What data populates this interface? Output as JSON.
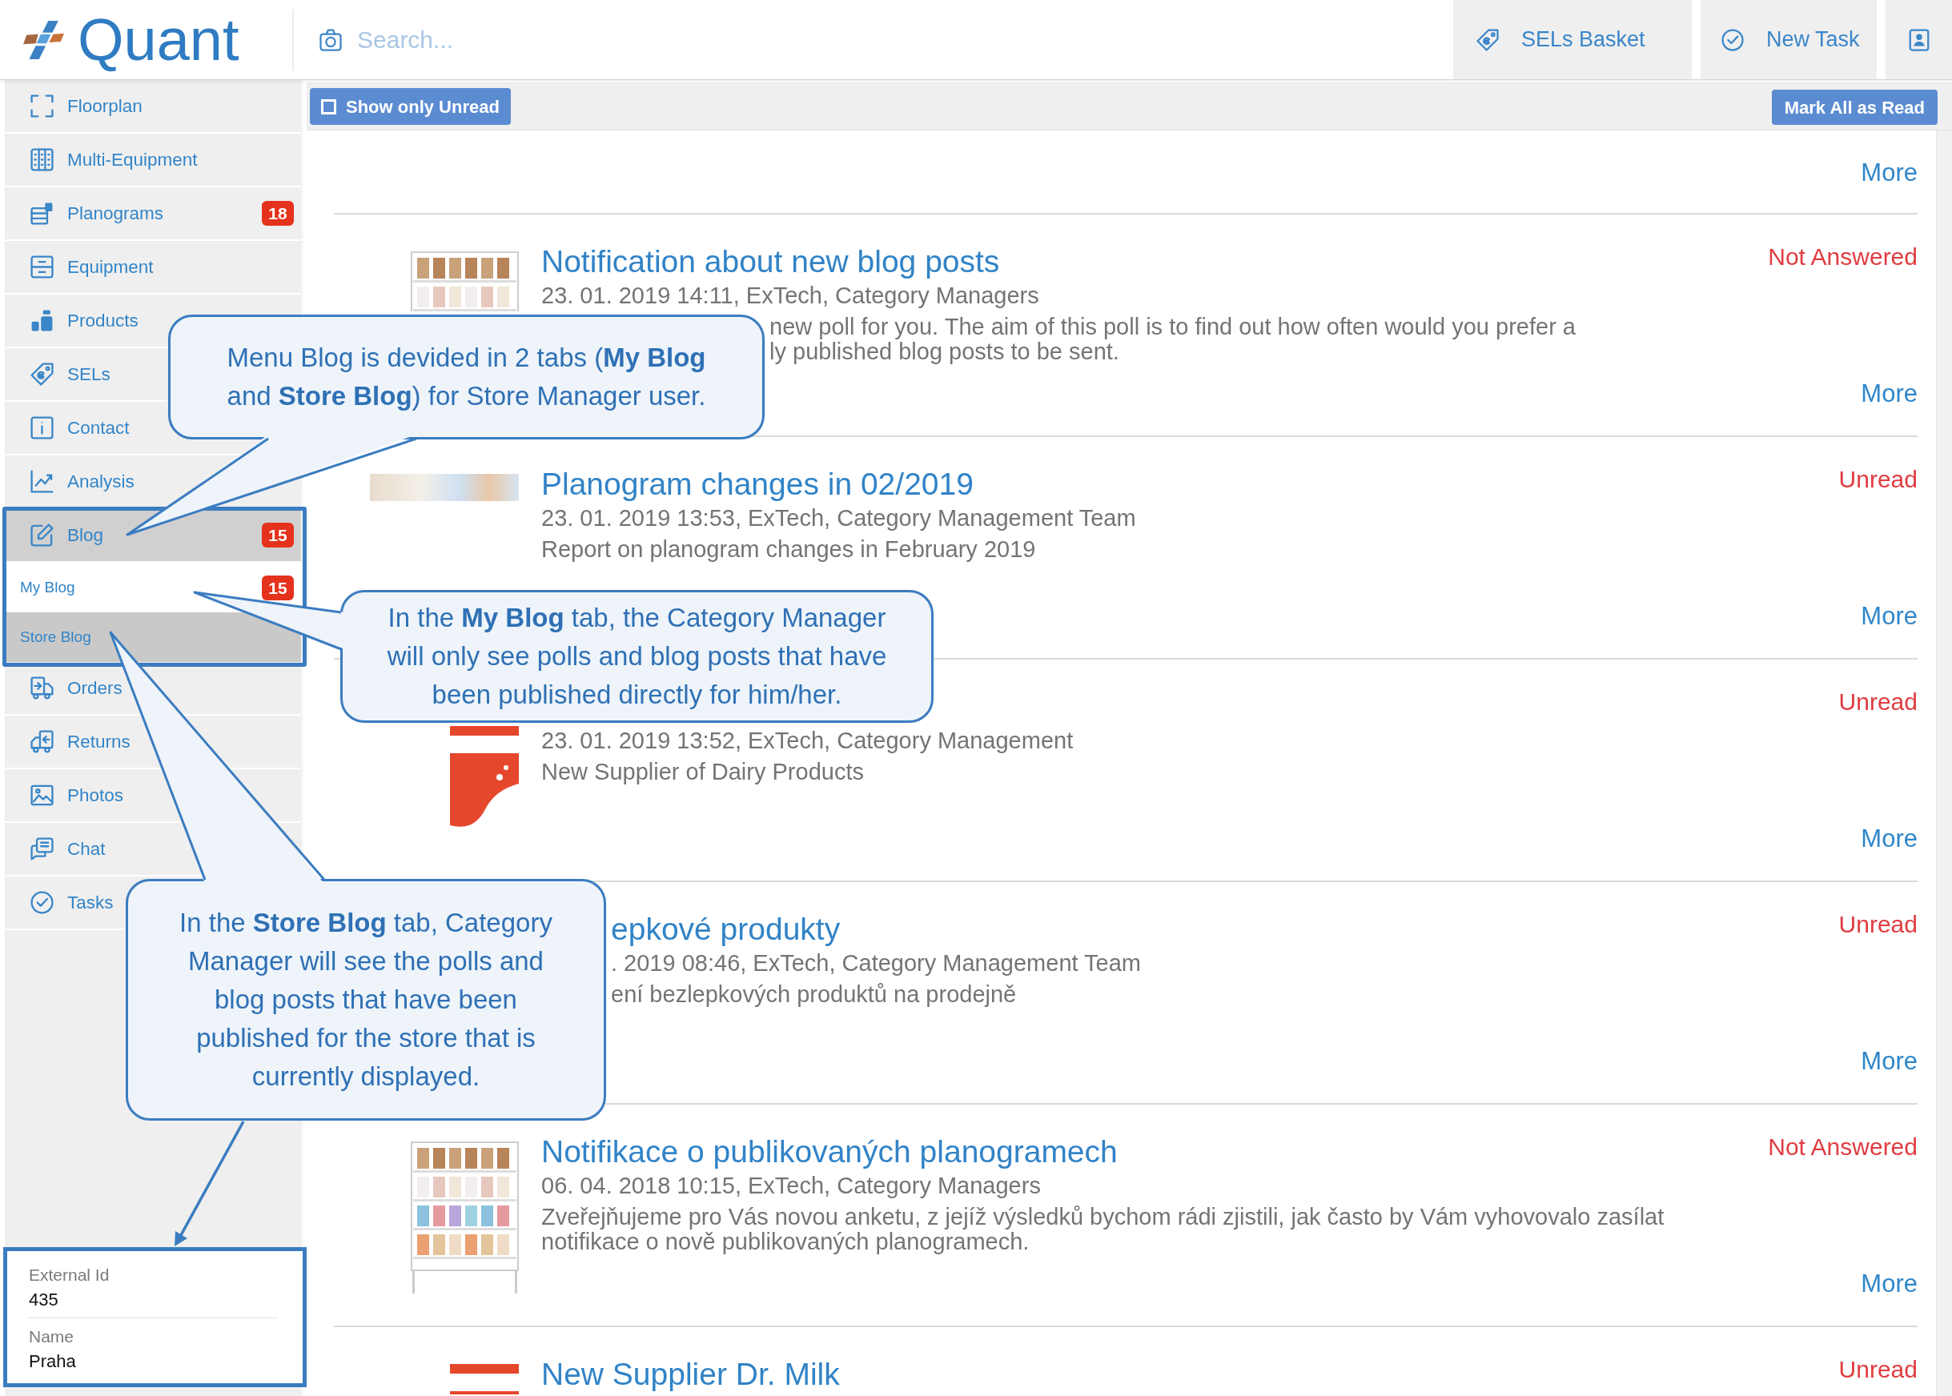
{
  "header": {
    "logo": "Quant",
    "search": {
      "placeholder": "Search..."
    },
    "buttons": [
      {
        "label": "SELs Basket"
      },
      {
        "label": "New Task"
      }
    ]
  },
  "sidebar": {
    "items": [
      {
        "label": "Floorplan",
        "selected": false
      },
      {
        "label": "Multi-Equipment",
        "selected": false
      },
      {
        "label": "Planograms",
        "badge": "18",
        "selected": false
      },
      {
        "label": "Equipment",
        "selected": false
      },
      {
        "label": "Products",
        "selected": false
      },
      {
        "label": "SELs",
        "selected": false
      },
      {
        "label": "Contact",
        "selected": false
      },
      {
        "label": "Analysis",
        "selected": false
      },
      {
        "label": "Blog",
        "badge": "15",
        "selected": true,
        "expanded": true,
        "highlighted": true,
        "children": [
          {
            "label": "My Blog",
            "badge": "15",
            "selected": true
          },
          {
            "label": "Store Blog",
            "selected": false
          }
        ]
      },
      {
        "label": "Orders",
        "selected": false
      },
      {
        "label": "Returns",
        "selected": false
      },
      {
        "label": "Photos",
        "selected": false
      },
      {
        "label": "Chat",
        "selected": false
      },
      {
        "label": "Tasks",
        "selected": false
      }
    ],
    "store_info": {
      "highlighted": true,
      "fields": [
        {
          "label": "External Id",
          "value": "435"
        },
        {
          "label": "Name",
          "value": "Praha"
        }
      ]
    }
  },
  "toolbar": {
    "filter": {
      "label": "Show only Unread",
      "checked": false
    },
    "mark_all_button": "Mark All as Read"
  },
  "posts": [
    {
      "more": "More"
    },
    {
      "thumbnail": {
        "kind": "shelf"
      },
      "title": "Notification about new blog posts",
      "meta": "23. 01. 2019 14:11, ExTech, Category Managers",
      "body": [
        "new poll for you. The aim of this poll is to find out how often would you prefer a",
        "ly published blog posts to be sent."
      ],
      "status": "Not Answered",
      "more": "More"
    },
    {
      "thumbnail": {
        "kind": "photo"
      },
      "title": "Planogram changes in 02/2019",
      "meta": "23. 01. 2019 13:53, ExTech, Category Management Team",
      "body": [
        "Report on planogram changes in February 2019"
      ],
      "status": "Unread",
      "more": "More"
    },
    {
      "thumbnail": {
        "kind": "carton"
      },
      "meta": "23. 01. 2019 13:52, ExTech, Category Management",
      "body": [
        "New Supplier of Dairy Products"
      ],
      "status": "Unread",
      "more": "More"
    },
    {
      "title": "epkové produkty",
      "meta": ". 2019 08:46, ExTech, Category Management Team",
      "body": [
        "ení bezlepkových produktů na prodejně"
      ],
      "status": "Unread",
      "more": "More"
    },
    {
      "thumbnail": {
        "kind": "shelf"
      },
      "title": "Notifikace o publikovaných planogramech",
      "meta": "06. 04. 2018 10:15, ExTech, Category Managers",
      "body": [
        "Zveřejňujeme pro Vás novou anketu, z jejíž výsledků bychom rádi zjistili, jak často by Vám vyhovovalo zasílat notifikace o nově publikovaných planogramech."
      ],
      "status": "Not Answered",
      "more": "More"
    },
    {
      "thumbnail": {
        "kind": "carton"
      },
      "title": "New Supplier Dr. Milk",
      "status": "Unread"
    }
  ],
  "annotations": [
    {
      "text": "Menu Blog is devided in 2 tabs (**My Blog** and **Store Blog**) for Store Manager user."
    },
    {
      "text": "In the **My Blog** tab, the Category Manager will only see polls and blog posts that have been published directly for him/her."
    },
    {
      "text": "In the **Store Blog** tab, Category Manager will see the polls and blog posts that have been published for the store that is currently displayed.",
      "arrow": true
    }
  ]
}
